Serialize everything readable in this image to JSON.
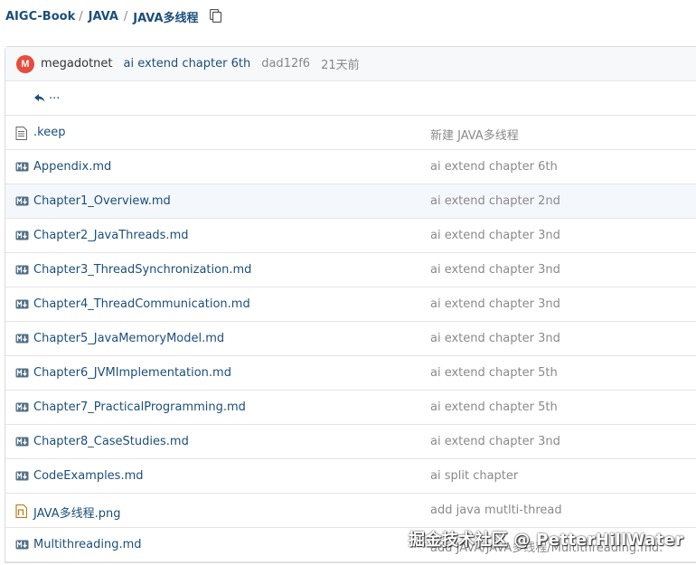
{
  "breadcrumb": {
    "items": [
      "AIGC-Book",
      "JAVA",
      "JAVA多线程"
    ],
    "separator": "/"
  },
  "commit": {
    "avatar_letter": "M",
    "author": "megadotnet",
    "message": "ai extend chapter 6th",
    "sha": "dad12f6",
    "ago": "21天前"
  },
  "up_label": "...",
  "files": [
    {
      "name": ".keep",
      "icon": "text-file-icon",
      "message": "新建 JAVA多线程"
    },
    {
      "name": "Appendix.md",
      "icon": "markdown-icon",
      "message": "ai extend chapter 6th"
    },
    {
      "name": "Chapter1_Overview.md",
      "icon": "markdown-icon",
      "message": "ai extend chapter 2nd"
    },
    {
      "name": "Chapter2_JavaThreads.md",
      "icon": "markdown-icon",
      "message": "ai extend chapter 3nd"
    },
    {
      "name": "Chapter3_ThreadSynchronization.md",
      "icon": "markdown-icon",
      "message": "ai extend chapter 3nd"
    },
    {
      "name": "Chapter4_ThreadCommunication.md",
      "icon": "markdown-icon",
      "message": "ai extend chapter 3nd"
    },
    {
      "name": "Chapter5_JavaMemoryModel.md",
      "icon": "markdown-icon",
      "message": "ai extend chapter 3nd"
    },
    {
      "name": "Chapter6_JVMImplementation.md",
      "icon": "markdown-icon",
      "message": "ai extend chapter 5th"
    },
    {
      "name": "Chapter7_PracticalProgramming.md",
      "icon": "markdown-icon",
      "message": "ai extend chapter 5th"
    },
    {
      "name": "Chapter8_CaseStudies.md",
      "icon": "markdown-icon",
      "message": "ai extend chapter 3nd"
    },
    {
      "name": "CodeExamples.md",
      "icon": "markdown-icon",
      "message": "ai split chapter"
    },
    {
      "name": "JAVA多线程.png",
      "icon": "image-file-icon",
      "message": "add java mutlti-thread"
    },
    {
      "name": "Multithreading.md",
      "icon": "markdown-icon",
      "message": "add JAVA/JAVA多线程/Multithreading.md."
    }
  ],
  "watermark": "掘金技术社区 @ PetterHillWater",
  "colors": {
    "link": "#1c4f7a",
    "muted": "#8a8a8a",
    "avatar": "#e74c3c",
    "header_bg": "#f7f8fa",
    "hover_row": "#f4f7fb"
  }
}
